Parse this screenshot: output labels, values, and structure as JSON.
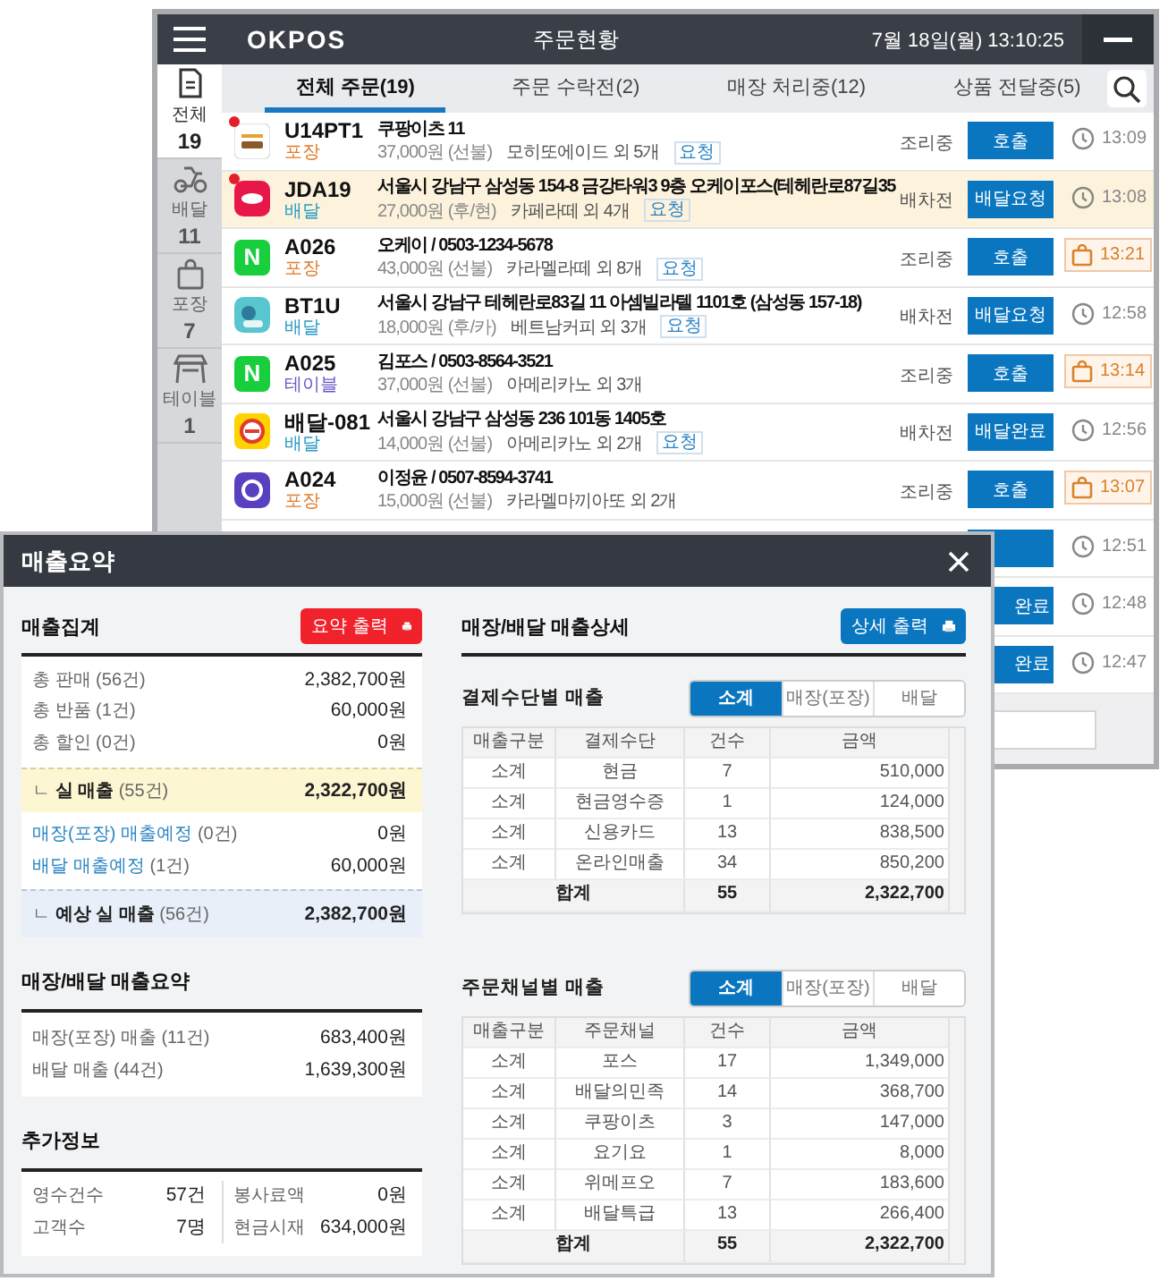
{
  "order_window": {
    "logo": "OKPOS",
    "title": "주문현황",
    "datetime": "7월 18일(월) 13:10:25",
    "sidebar": [
      {
        "label": "전체",
        "count": "19",
        "selected": true
      },
      {
        "label": "배달",
        "count": "11",
        "selected": false
      },
      {
        "label": "포장",
        "count": "7",
        "selected": false
      },
      {
        "label": "테이블",
        "count": "1",
        "selected": false
      }
    ],
    "tabs": [
      {
        "label": "전체 주문(19)",
        "selected": true
      },
      {
        "label": "주문 수락전(2)",
        "selected": false
      },
      {
        "label": "매장 처리중(12)",
        "selected": false
      },
      {
        "label": "상품 전달중(5)",
        "selected": false
      }
    ],
    "orders": [
      {
        "logo": {
          "kind": "coupang",
          "new": true
        },
        "code": "U14PT1",
        "order_type": {
          "label": "포장",
          "color": "#e07b2a"
        },
        "title": "쿠팡이츠 11",
        "price": "37,000원",
        "payment": "(선불)",
        "items": "모히또에이드 외 5개",
        "tag": "요청",
        "status": "조리중",
        "action": "호출",
        "time": {
          "text": "13:09",
          "kind": "clock"
        },
        "selected": false
      },
      {
        "logo": {
          "kind": "yogiyo",
          "new": true
        },
        "code": "JDA19",
        "order_type": {
          "label": "배달",
          "color": "#2a9bc4"
        },
        "title": "서울시 강남구 삼성동 154-8 금강타워3 9층 오케이포스(테헤란로87길35",
        "price": "27,000원",
        "payment": "(후/현)",
        "items": "카페라떼 외 4개",
        "tag": "요청",
        "status": "배차전",
        "action": "배달요청",
        "time": {
          "text": "13:08",
          "kind": "clock"
        },
        "selected": true
      },
      {
        "logo": {
          "kind": "naver",
          "text": "N",
          "new": false
        },
        "code": "A026",
        "order_type": {
          "label": "포장",
          "color": "#e07b2a"
        },
        "title": "오케이 / 0503-1234-5678",
        "price": "43,000원",
        "payment": "(선불)",
        "items": "카라멜라떼 외 8개",
        "tag": "요청",
        "status": "조리중",
        "action": "호출",
        "time": {
          "text": "13:21",
          "kind": "bag"
        },
        "selected": false
      },
      {
        "logo": {
          "kind": "baemin",
          "new": false
        },
        "code": "BT1U",
        "order_type": {
          "label": "배달",
          "color": "#2a9bc4"
        },
        "title": "서울시  강남구 테헤란로83길 11 아셈빌라텔 1101호 (삼성동 157-18)",
        "price": "18,000원",
        "payment": "(후/카)",
        "items": "베트남커피 외 3개",
        "tag": "요청",
        "status": "배차전",
        "action": "배달요청",
        "time": {
          "text": "12:58",
          "kind": "clock"
        },
        "selected": false
      },
      {
        "logo": {
          "kind": "naver",
          "text": "N",
          "new": false
        },
        "code": "A025",
        "order_type": {
          "label": "테이블",
          "color": "#6a58c4"
        },
        "title": "김포스 / 0503-8564-3521",
        "price": "37,000원",
        "payment": "(선불)",
        "items": "아메리카노 외 3개",
        "status": "조리중",
        "action": "호출",
        "time": {
          "text": "13:14",
          "kind": "bag"
        },
        "selected": false
      },
      {
        "logo": {
          "kind": "ddangyo",
          "new": false
        },
        "code": "배달-081",
        "order_type": {
          "label": "배달",
          "color": "#2a9bc4"
        },
        "title": "서울시 강남구 삼성동 236 101동 1405호",
        "price": "14,000원",
        "payment": "(선불)",
        "items": "아메리카노 외 2개",
        "tag": "요청",
        "status": "배차전",
        "action": "배달완료",
        "time": {
          "text": "12:56",
          "kind": "clock"
        },
        "selected": false
      },
      {
        "logo": {
          "kind": "circle",
          "new": false
        },
        "code": "A024",
        "order_type": {
          "label": "포장",
          "color": "#e07b2a"
        },
        "title": "이정윤 / 0507-8594-3741",
        "price": "15,000원",
        "payment": "(선불)",
        "items": "카라멜마끼아또 외 2개",
        "status": "조리중",
        "action": "호출",
        "time": {
          "text": "13:07",
          "kind": "bag"
        },
        "selected": false
      },
      {
        "time": {
          "text": "12:51",
          "kind": "clock"
        },
        "selected": false
      },
      {
        "action": "완료",
        "time": {
          "text": "12:48",
          "kind": "clock"
        },
        "selected": false
      },
      {
        "action": "완료",
        "time": {
          "text": "12:47",
          "kind": "clock"
        },
        "selected": false
      }
    ]
  },
  "summary_dialog": {
    "title": "매출요약",
    "sales_total": {
      "heading": "매출집계",
      "print_button": "요약 출력",
      "rows": [
        {
          "kind": "plain",
          "label": "총 판매 (56건)",
          "value": "2,382,700원"
        },
        {
          "kind": "plain",
          "label": "총 반품 (1건)",
          "value": "60,000원"
        },
        {
          "kind": "plain",
          "label": "총 할인 (0건)",
          "value": "0원"
        },
        {
          "kind": "total",
          "label": "ㄴ **실 매출** (55건)",
          "value": "2,322,700원"
        },
        {
          "kind": "link",
          "label": "매장(포장) 매출예정",
          "count": "(0건)",
          "value": "0원"
        },
        {
          "kind": "link",
          "label": "배달 매출예정",
          "count": "(1건)",
          "value": "60,000원"
        },
        {
          "kind": "expected",
          "label": "ㄴ **예상 실 매출** (56건)",
          "value": "2,382,700원"
        }
      ]
    },
    "store_summary": {
      "heading": "매장/배달 매출요약",
      "rows": [
        {
          "label": "매장(포장) 매출 (11건)",
          "value": "683,400원"
        },
        {
          "label": "배달 매출 (44건)",
          "value": "1,639,300원"
        }
      ]
    },
    "extra_info": {
      "heading": "추가정보",
      "items": [
        {
          "label": "영수건수",
          "value": "57건"
        },
        {
          "label": "고객수",
          "value": "7명"
        },
        {
          "label": "봉사료액",
          "value": "0원"
        },
        {
          "label": "현금시재",
          "value": "634,000원"
        }
      ]
    },
    "detail": {
      "heading": "매장/배달 매출상세",
      "print_button": "상세 출력",
      "tables": [
        {
          "title": "결제수단별 매출",
          "filters": [
            {
              "label": "소계",
              "selected": true
            },
            {
              "label": "매장(포장)",
              "selected": false
            },
            {
              "label": "배달",
              "selected": false
            }
          ],
          "columns": [
            "매출구분",
            "결제수단",
            "건수",
            "금액"
          ],
          "rows": [
            [
              "소계",
              "현금",
              "7",
              "510,000"
            ],
            [
              "소계",
              "현금영수증",
              "1",
              "124,000"
            ],
            [
              "소계",
              "신용카드",
              "13",
              "838,500"
            ],
            [
              "소계",
              "온라인매출",
              "34",
              "850,200"
            ]
          ],
          "total": {
            "label": "합계",
            "count": "55",
            "amount": "2,322,700"
          }
        },
        {
          "title": "주문채널별 매출",
          "filters": [
            {
              "label": "소계",
              "selected": true
            },
            {
              "label": "매장(포장)",
              "selected": false
            },
            {
              "label": "배달",
              "selected": false
            }
          ],
          "columns": [
            "매출구분",
            "주문채널",
            "건수",
            "금액"
          ],
          "rows": [
            [
              "소계",
              "포스",
              "17",
              "1,349,000"
            ],
            [
              "소계",
              "배달의민족",
              "14",
              "368,700"
            ],
            [
              "소계",
              "쿠팡이츠",
              "3",
              "147,000"
            ],
            [
              "소계",
              "요기요",
              "1",
              "8,000"
            ],
            [
              "소계",
              "위메프오",
              "7",
              "183,600"
            ],
            [
              "소계",
              "배달특급",
              "13",
              "266,400"
            ]
          ],
          "total": {
            "label": "합계",
            "count": "55",
            "amount": "2,322,700"
          }
        }
      ]
    }
  }
}
